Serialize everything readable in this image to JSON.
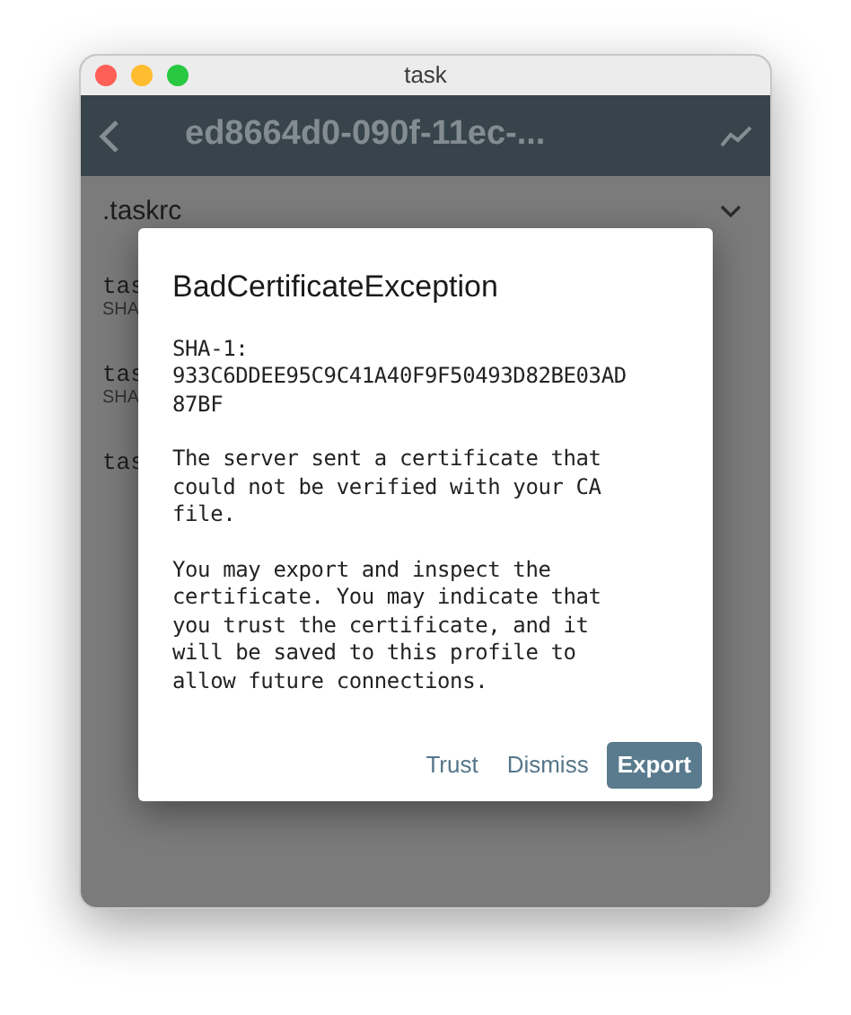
{
  "window": {
    "title": "task"
  },
  "app_bar": {
    "title": "ed8664d0-090f-11ec-..."
  },
  "section": {
    "label": ".taskrc",
    "expanded": false
  },
  "items": [
    {
      "name": "tas",
      "sub": "SHA"
    },
    {
      "name": "tas",
      "sub": "SHA"
    },
    {
      "name": "tas"
    }
  ],
  "dialog": {
    "title": "BadCertificateException",
    "paragraphs": [
      "SHA-1:\n933C6DDEE95C9C41A40F9F50493D82BE03AD\n87BF",
      "The server sent a certificate that\ncould not be verified with your CA\nfile.",
      "You may export and inspect the\ncertificate. You may indicate that\nyou trust the certificate, and it\nwill be saved to this profile to\nallow future connections."
    ],
    "buttons": [
      {
        "label": "Trust",
        "kind": "text"
      },
      {
        "label": "Dismiss",
        "kind": "text"
      },
      {
        "label": "Export",
        "kind": "filled"
      }
    ]
  }
}
